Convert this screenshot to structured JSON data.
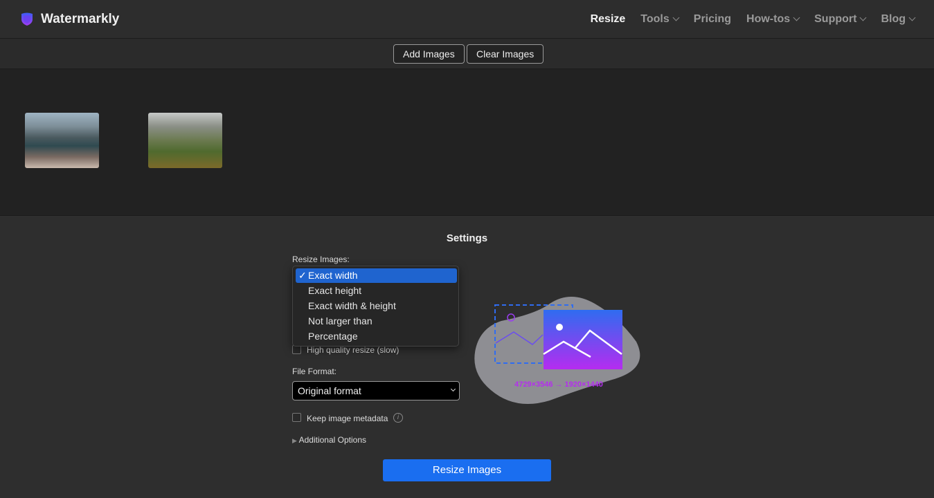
{
  "header": {
    "brand": "Watermarkly",
    "nav": [
      {
        "label": "Resize",
        "active": true
      },
      {
        "label": "Tools",
        "dropdown": true
      },
      {
        "label": "Pricing"
      },
      {
        "label": "How-tos",
        "dropdown": true
      },
      {
        "label": "Support",
        "dropdown": true
      },
      {
        "label": "Blog",
        "dropdown": true
      }
    ]
  },
  "toolbar": {
    "add": "Add Images",
    "clear": "Clear Images"
  },
  "settings": {
    "title": "Settings",
    "resize_label": "Resize Images:",
    "resize_options": [
      "Exact width",
      "Exact height",
      "Exact width & height",
      "Not larger than",
      "Percentage"
    ],
    "selected": "Exact width",
    "check_mark": "✓",
    "hq_label": "High quality resize (slow)",
    "format_label": "File Format:",
    "format_value": "Original format",
    "metadata_label": "Keep image metadata",
    "info": "i",
    "additional": "Additional Options",
    "submit": "Resize Images"
  },
  "illustration": {
    "caption": "4729×3546 → 1920×1440"
  },
  "colors": {
    "accent": "#1a6ef0",
    "selected": "#1f64cf",
    "gradient_top": "#2f6cf0",
    "gradient_bottom": "#b52cf0"
  }
}
